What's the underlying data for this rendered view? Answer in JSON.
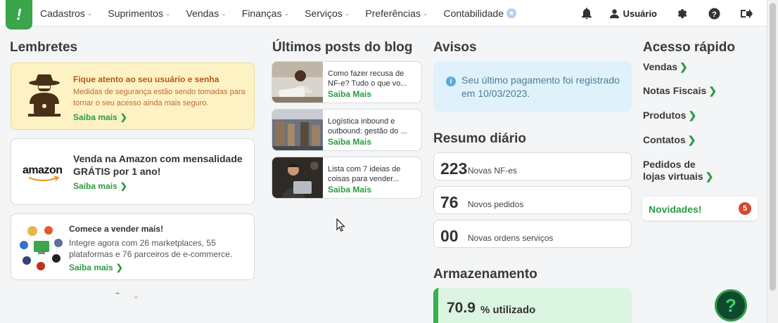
{
  "nav": {
    "logo": "!",
    "items": [
      {
        "label": "Cadastros",
        "chevron": true
      },
      {
        "label": "Suprimentos",
        "chevron": true
      },
      {
        "label": "Vendas",
        "chevron": true
      },
      {
        "label": "Finanças",
        "chevron": true
      },
      {
        "label": "Serviços",
        "chevron": true
      },
      {
        "label": "Preferências",
        "chevron": true
      },
      {
        "label": "Contabilidade",
        "chevron": false
      }
    ],
    "user_label": "Usuário",
    "icons": [
      "bell-icon",
      "user-icon",
      "gear-icon",
      "help-icon",
      "logout-icon"
    ]
  },
  "lembretes": {
    "title": "Lembretes",
    "cards": [
      {
        "title": "Fique atento ao seu usuário e senha",
        "desc": "Medidas de segurança estão sendo tomadas para tornar o seu acesso ainda mais seguro.",
        "link": "Saiba mais"
      },
      {
        "brand": "amazon",
        "title": "Venda na Amazon com mensalidade GRÁTIS por 1 ano!",
        "link": "Saiba mais"
      },
      {
        "title": "Comece a vender mais!",
        "desc": "Integre agora com 26 marketplaces, 55 plataformas e 76 parceiros de e-commerce.",
        "link": "Saiba mais"
      }
    ],
    "pager_up": "⌃",
    "pager_down": "⌄"
  },
  "blog": {
    "title": "Últimos posts do blog",
    "posts": [
      {
        "text": "Como fazer recusa de NF-e? Tudo o que vo...",
        "link": "Saiba Mais"
      },
      {
        "text": "Logística inbound e outbound: gestão do ...",
        "link": "Saiba Mais"
      },
      {
        "text": "Lista com 7 ideias de coisas para vender...",
        "link": "Saiba Mais"
      }
    ]
  },
  "avisos": {
    "title": "Avisos",
    "message": "Seu último pagamento foi registrado em 10/03/2023."
  },
  "resumo": {
    "title": "Resumo diário",
    "items": [
      {
        "value": "223",
        "label": "Novas NF-es"
      },
      {
        "value": "76",
        "label": "Novos pedidos"
      },
      {
        "value": "00",
        "label": "Novas ordens serviços"
      }
    ]
  },
  "armazenamento": {
    "title": "Armazenamento",
    "percent": "70.9",
    "label": "% utilizado"
  },
  "acesso": {
    "title": "Acesso rápido",
    "links": [
      "Vendas",
      "Notas Fiscais",
      "Produtos",
      "Contatos",
      "Pedidos de lojas virtuais"
    ],
    "novidades_label": "Novidades!",
    "novidades_count": "5"
  },
  "help_fab": "?",
  "colors": {
    "brand_green": "#3aa54a",
    "link_green": "#2e9a46",
    "warning_bg": "#fdf2c4",
    "info_bg": "#dff2fb",
    "badge_red": "#d8472b"
  }
}
